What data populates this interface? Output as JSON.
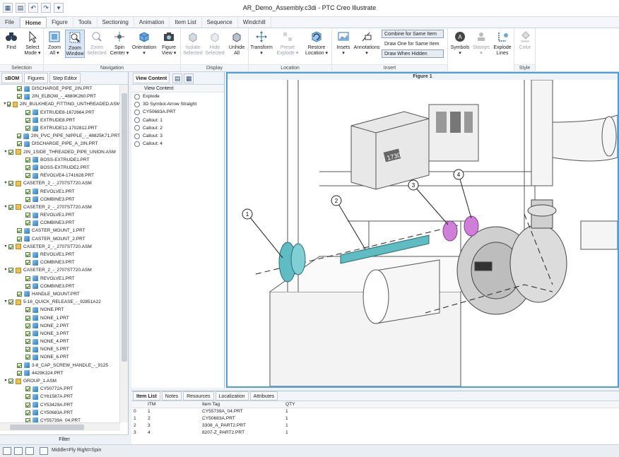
{
  "titlebar": {
    "title": "AR_Demo_Assembly.c3di - PTC Creo Illustrate"
  },
  "ribbon_tabs": [
    "File",
    "Home",
    "Figure",
    "Tools",
    "Sectioning",
    "Animation",
    "Item List",
    "Sequence",
    "Windchill"
  ],
  "ribbon": {
    "groups": {
      "selection": "Selection",
      "navigation": "Navigation",
      "display": "Display",
      "location": "Location",
      "insert": "Insert",
      "style": "Style"
    },
    "buttons": {
      "find": "Find",
      "select_mode": "Select\nMode ▾",
      "zoom_all": "Zoom\nAll ▾",
      "zoom_window": "Zoom\nWindow",
      "zoom_selected": "Zoom\nSelected",
      "spin_center": "Spin\nCenter ▾",
      "orientation": "Orientation\n▾",
      "figure_view": "Figure\nView ▾",
      "isolate": "Isolate\nSelected",
      "hide": "Hide\nSelected",
      "unhide": "Unhide\nAll",
      "transform": "Transform\n▾",
      "preset_explode": "Preset\nExplode ▾",
      "restore_location": "Restore\nLocation ▾",
      "insets": "Insets\n▾",
      "annotations": "Annotations\n▾",
      "symbols": "Symbols\n▾",
      "stamps": "Stamps\n▾",
      "explode_lines": "Explode\nLines",
      "color": "Color"
    },
    "insert_options": [
      "Combine for Same Item",
      "Draw One for Same Item",
      "Draw When Hidden"
    ]
  },
  "left_panel": {
    "tabs": [
      "sBOM",
      "Figures",
      "Step Editor"
    ],
    "tree": [
      {
        "label": "DISCHARGE_PIPE_2IN.PRT",
        "level": 1,
        "kind": "part"
      },
      {
        "label": "2IN_ELBOW_-_4880K260.PRT",
        "level": 1,
        "kind": "part"
      },
      {
        "label": "2IN_BULKHEAD_FITTING_UNTHREADED.ASM",
        "level": 0,
        "kind": "asm",
        "exp": "▾"
      },
      {
        "label": "EXTRUDE8-1672664.PRT",
        "level": 2,
        "kind": "part"
      },
      {
        "label": "EXTRUDE8.PRT",
        "level": 2,
        "kind": "part"
      },
      {
        "label": "EXTRUDE12-1702812.PRT",
        "level": 2,
        "kind": "part"
      },
      {
        "label": "2IN_PVC_PIPE_NIPPLE_-_48825K71.PRT",
        "level": 1,
        "kind": "part"
      },
      {
        "label": "DISCHARGE_PIPE_A_2IN.PRT",
        "level": 1,
        "kind": "part"
      },
      {
        "label": "2IN_1SIDE_THREADED_PIPE_UNION.ASM",
        "level": 0,
        "kind": "asm",
        "exp": "▾"
      },
      {
        "label": "BOSS-EXTRUDE1.PRT",
        "level": 2,
        "kind": "part"
      },
      {
        "label": "BOSS-EXTRUDE2.PRT",
        "level": 2,
        "kind": "part"
      },
      {
        "label": "REVOLVE4-1741628.PRT",
        "level": 2,
        "kind": "part"
      },
      {
        "label": "CASETER_2_-_2707ST720.ASM",
        "level": 0,
        "kind": "asm",
        "exp": "▾"
      },
      {
        "label": "REVOLVE1.PRT",
        "level": 2,
        "kind": "part"
      },
      {
        "label": "COMBINE3.PRT",
        "level": 2,
        "kind": "part"
      },
      {
        "label": "CASETER_2_-_2707ST720.ASM",
        "level": 0,
        "kind": "asm",
        "exp": "▾"
      },
      {
        "label": "REVOLVE1.PRT",
        "level": 2,
        "kind": "part"
      },
      {
        "label": "COMBINE3.PRT",
        "level": 2,
        "kind": "part"
      },
      {
        "label": "CASTER_MOUNT_1.PRT",
        "level": 1,
        "kind": "part"
      },
      {
        "label": "CASTER_MOUNT_2.PRT",
        "level": 1,
        "kind": "part"
      },
      {
        "label": "CASETER_2_-_2707ST720.ASM",
        "level": 0,
        "kind": "asm",
        "exp": "▾"
      },
      {
        "label": "REVOLVE1.PRT",
        "level": 2,
        "kind": "part"
      },
      {
        "label": "COMBINE3.PRT",
        "level": 2,
        "kind": "part"
      },
      {
        "label": "CASETER_2_-_2707ST720.ASM",
        "level": 0,
        "kind": "asm",
        "exp": "▾"
      },
      {
        "label": "REVOLVE1.PRT",
        "level": 2,
        "kind": "part"
      },
      {
        "label": "COMBINE3.PRT",
        "level": 2,
        "kind": "part"
      },
      {
        "label": "HANDLE_MOUNT.PRT",
        "level": 1,
        "kind": "part"
      },
      {
        "label": "5-16_QUICK_RELEASE_-_92851A22",
        "level": 0,
        "kind": "asm",
        "exp": "▾"
      },
      {
        "label": "NONE.PRT",
        "level": 2,
        "kind": "part"
      },
      {
        "label": "NONE_1.PRT",
        "level": 2,
        "kind": "part"
      },
      {
        "label": "NONE_2.PRT",
        "level": 2,
        "kind": "part"
      },
      {
        "label": "NONE_3.PRT",
        "level": 2,
        "kind": "part"
      },
      {
        "label": "NONE_4.PRT",
        "level": 2,
        "kind": "part"
      },
      {
        "label": "NONE_5.PRT",
        "level": 2,
        "kind": "part"
      },
      {
        "label": "NONE_6.PRT",
        "level": 2,
        "kind": "part"
      },
      {
        "label": "3-8_CAP_SCREW_HANDLE_-_9125",
        "level": 1,
        "kind": "part"
      },
      {
        "label": "4429K324.PRT",
        "level": 1,
        "kind": "part"
      },
      {
        "label": "GROUP_1.ASM",
        "level": 0,
        "kind": "asm",
        "exp": "▾"
      },
      {
        "label": "CY50772A.PRT",
        "level": 2,
        "kind": "part"
      },
      {
        "label": "CY61587A.PRT",
        "level": 2,
        "kind": "part"
      },
      {
        "label": "CY53429A.PRT",
        "level": 2,
        "kind": "part"
      },
      {
        "label": "CY50683A.PRT",
        "level": 2,
        "kind": "part"
      },
      {
        "label": "CY55739A_04.PRT",
        "level": 2,
        "kind": "part"
      }
    ],
    "filter_label": "Filter"
  },
  "view_content": {
    "tab": "View Content",
    "header": "View Content",
    "items": [
      "Explode",
      "3D Symbol-Arrow Straight",
      "CY50683A.PRT",
      "Callout: 1",
      "Callout: 2",
      "Callout: 3",
      "Callout: 4"
    ]
  },
  "viewport": {
    "title": "Figure 1",
    "logo_text": "1730",
    "callouts": [
      "1",
      "2",
      "3",
      "4"
    ],
    "accent_color": "#4d9fdb",
    "highlight_color": "#d07fd8",
    "shaft_color": "#5fbcc2"
  },
  "bottom_panel": {
    "tabs": [
      "Item List",
      "Notes",
      "Resources",
      "Localization",
      "Attributes"
    ],
    "columns": [
      "",
      "ITM",
      "Item Tag",
      "QTY"
    ],
    "rows": [
      [
        "0",
        "1",
        "CY55739A_04.PRT",
        "1"
      ],
      [
        "1",
        "2",
        "CY50683A.PRT",
        "1"
      ],
      [
        "2",
        "3",
        "3308_A_PART2.PRT",
        "1"
      ],
      [
        "3",
        "4",
        "8207-Z_PART2.PRT",
        "1"
      ]
    ]
  },
  "statusbar": {
    "text": "Middle=Fly  Right=Spin"
  }
}
